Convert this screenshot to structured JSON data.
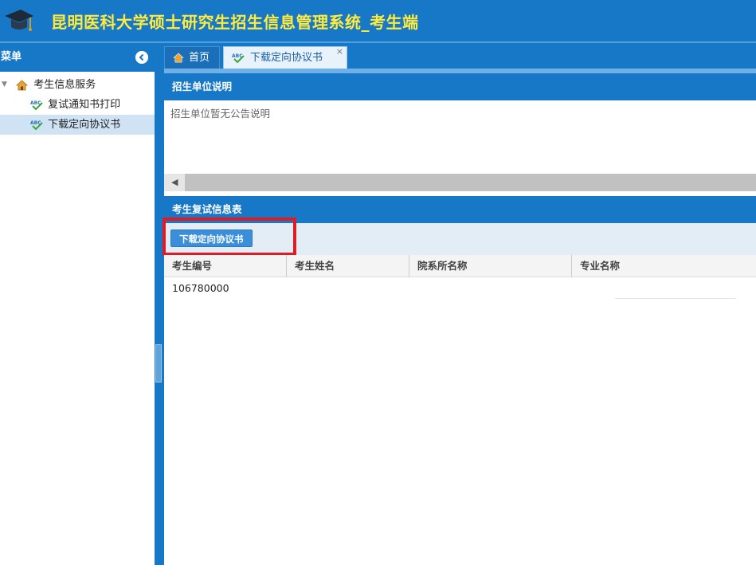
{
  "header": {
    "title": "昆明医科大学硕士研究生招生信息管理系统_考生端",
    "logo_icon": "graduation-cap-icon"
  },
  "sidebar": {
    "title": "菜单",
    "collapse_icon": "chevron-left-icon",
    "tree": {
      "root": {
        "label": "考生信息服务",
        "icon": "house-icon"
      },
      "children": [
        {
          "label": "复试通知书打印",
          "icon": "abc-check-icon",
          "selected": false
        },
        {
          "label": "下载定向协议书",
          "icon": "abc-check-icon",
          "selected": true
        }
      ]
    }
  },
  "tabs": [
    {
      "label": "首页",
      "icon": "house-icon",
      "active": false
    },
    {
      "label": "下载定向协议书",
      "icon": "abc-check-icon",
      "active": true,
      "close": "×"
    }
  ],
  "notice_panel": {
    "title": "招生单位说明",
    "text": "招生单位暂无公告说明"
  },
  "grid_panel": {
    "title": "考生复试信息表",
    "download_button": "下载定向协议书",
    "columns": [
      "考生编号",
      "考生姓名",
      "院系所名称",
      "专业名称"
    ],
    "rows": [
      [
        "106780000",
        "",
        "",
        ""
      ]
    ]
  },
  "colors": {
    "primary": "#1878c8",
    "title": "#ffeb3b",
    "highlight": "#e11b24",
    "selected": "#cfe3f5"
  }
}
